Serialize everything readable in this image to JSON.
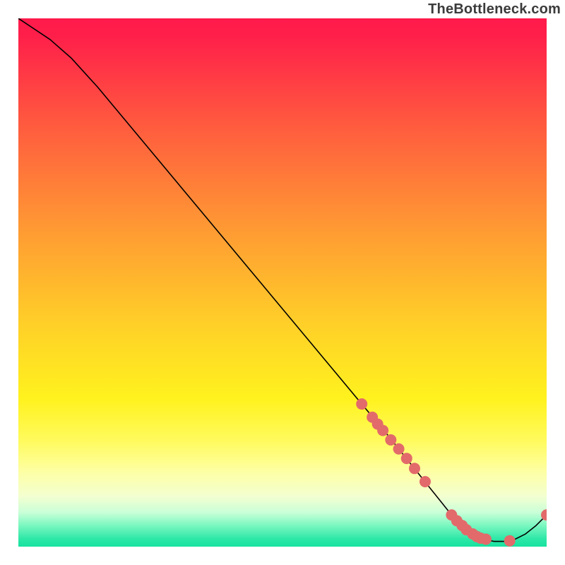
{
  "watermark": "TheBottleneck.com",
  "chart_data": {
    "type": "line",
    "title": "",
    "xlabel": "",
    "ylabel": "",
    "xlim": [
      0,
      100
    ],
    "ylim": [
      0,
      100
    ],
    "x": [
      0,
      6,
      10,
      15,
      20,
      25,
      30,
      35,
      40,
      45,
      50,
      55,
      60,
      65,
      70,
      72,
      74,
      76,
      78,
      80,
      82,
      84,
      86,
      88,
      90,
      92,
      94,
      96,
      98,
      100
    ],
    "values": [
      100,
      96,
      92.5,
      87,
      81,
      75,
      69,
      63,
      57,
      51,
      45,
      39,
      33,
      27,
      21,
      18.5,
      16,
      13.5,
      11,
      8.5,
      6,
      4,
      2.4,
      1.4,
      1.0,
      1.0,
      1.4,
      2.4,
      4.0,
      6.0
    ],
    "markers": {
      "x": [
        65,
        67,
        68,
        69,
        70.5,
        72,
        73.5,
        75,
        77,
        82,
        83,
        84,
        84.8,
        86,
        86.8,
        87.5,
        88.5,
        93,
        100
      ],
      "y": [
        27,
        24.5,
        23.2,
        22,
        20.2,
        18.5,
        16.7,
        14.8,
        12.3,
        6.0,
        4.9,
        4.0,
        3.2,
        2.4,
        1.9,
        1.6,
        1.4,
        1.1,
        6.0
      ]
    },
    "gradient_stops": [
      {
        "offset": 0.0,
        "color": "#ff1a4b"
      },
      {
        "offset": 0.03,
        "color": "#ff1e4a"
      },
      {
        "offset": 0.2,
        "color": "#ff5a3f"
      },
      {
        "offset": 0.4,
        "color": "#ff9a33"
      },
      {
        "offset": 0.58,
        "color": "#ffd028"
      },
      {
        "offset": 0.72,
        "color": "#fff21e"
      },
      {
        "offset": 0.8,
        "color": "#fffb5e"
      },
      {
        "offset": 0.86,
        "color": "#fdffa6"
      },
      {
        "offset": 0.905,
        "color": "#f3ffd0"
      },
      {
        "offset": 0.935,
        "color": "#caffd8"
      },
      {
        "offset": 0.96,
        "color": "#7af7c0"
      },
      {
        "offset": 0.985,
        "color": "#2ee8a8"
      },
      {
        "offset": 1.0,
        "color": "#17e29f"
      }
    ],
    "line_color": "#000000",
    "marker_fill": "#e36a6a",
    "marker_stroke": "#c94f4f",
    "marker_radius": 8
  }
}
